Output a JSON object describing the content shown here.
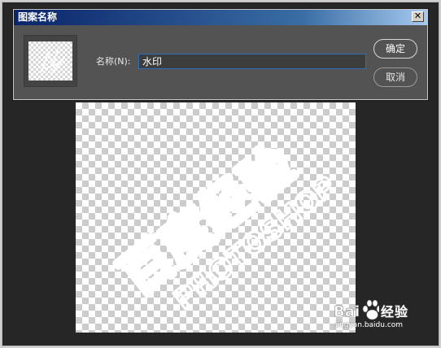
{
  "dialog": {
    "title": "图案名称",
    "close_label": "✕",
    "name_label": "名称(N):",
    "name_value": "水印",
    "ok_label": "确定",
    "cancel_label": "取消"
  },
  "watermark": {
    "main_text": "百度经验",
    "sub_text": "PHOTOSHOP"
  },
  "site_logo": {
    "name": "经验",
    "brand": "Bai",
    "url": "jingyan.baidu.com"
  },
  "colors": {
    "titlebar_start": "#0a246a",
    "input_border": "#2f6fc0",
    "dialog_bg": "#535353"
  }
}
